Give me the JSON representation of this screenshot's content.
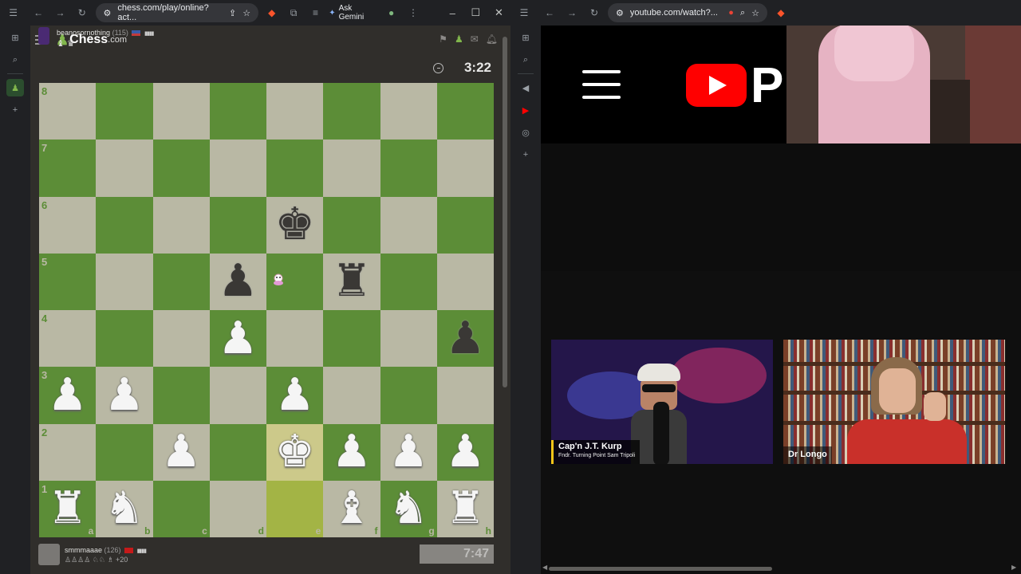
{
  "left_browser": {
    "url": "chess.com/play/online?act...",
    "gemini_label": "Ask Gemini"
  },
  "chess": {
    "logo_text": "Chess",
    "logo_suffix": ".com",
    "opponent": {
      "name": "beanosornothing",
      "rating": "(115)",
      "captured": "♝ ♛",
      "clock": "3:22"
    },
    "player": {
      "name": "smmmaaae",
      "rating": "(126)",
      "captured": "+20",
      "clock": "7:47"
    },
    "ranks": [
      "8",
      "7",
      "6",
      "5",
      "4",
      "3",
      "2",
      "1"
    ],
    "files": [
      "a",
      "b",
      "c",
      "d",
      "e",
      "f",
      "g",
      "h"
    ],
    "pieces": [
      {
        "sq": "e6",
        "glyph": "♚",
        "color": "b"
      },
      {
        "sq": "d5",
        "glyph": "♟",
        "color": "b"
      },
      {
        "sq": "f5",
        "glyph": "♜",
        "color": "b"
      },
      {
        "sq": "d4",
        "glyph": "♟",
        "color": "w"
      },
      {
        "sq": "h4",
        "glyph": "♟",
        "color": "b"
      },
      {
        "sq": "a3",
        "glyph": "♟",
        "color": "w"
      },
      {
        "sq": "b3",
        "glyph": "♟",
        "color": "w"
      },
      {
        "sq": "e3",
        "glyph": "♟",
        "color": "w"
      },
      {
        "sq": "c2",
        "glyph": "♟",
        "color": "w"
      },
      {
        "sq": "e2",
        "glyph": "♚",
        "color": "w"
      },
      {
        "sq": "f2",
        "glyph": "♟",
        "color": "w"
      },
      {
        "sq": "g2",
        "glyph": "♟",
        "color": "w"
      },
      {
        "sq": "h2",
        "glyph": "♟",
        "color": "w"
      },
      {
        "sq": "a1",
        "glyph": "♜",
        "color": "w"
      },
      {
        "sq": "b1",
        "glyph": "♞",
        "color": "w"
      },
      {
        "sq": "f1",
        "glyph": "♝",
        "color": "w"
      },
      {
        "sq": "g1",
        "glyph": "♞",
        "color": "w"
      },
      {
        "sq": "h1",
        "glyph": "♜",
        "color": "w"
      }
    ],
    "highlighted": [
      "e2",
      "e1"
    ],
    "colors": {
      "light": "#b9b8a4",
      "dark": "#5c8d37"
    }
  },
  "right_browser": {
    "url": "youtube.com/watch?..."
  },
  "youtube": {
    "banner_text": "Pr",
    "guest1": {
      "name": "Cap'n J.T. Kurp",
      "subtitle": "Fndr. Turning Point Sam Tripoli"
    },
    "guest2": {
      "name": "Dr Longo"
    }
  },
  "icons": {
    "back": "back-arrow-icon",
    "reload": "reload-icon",
    "star": "bookmark-star-icon",
    "menu": "menu-icon"
  }
}
